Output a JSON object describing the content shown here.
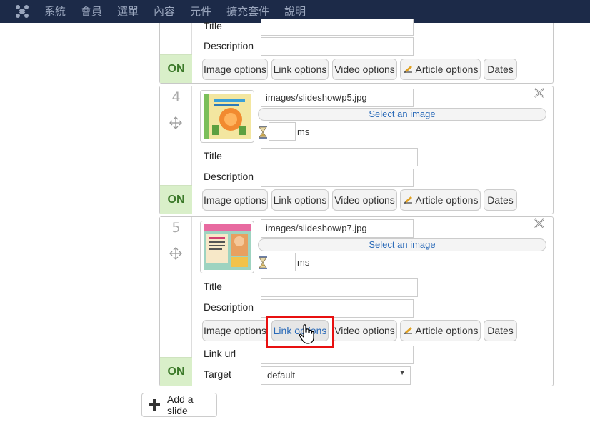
{
  "topbar": {
    "menu": [
      "系統",
      "會員",
      "選單",
      "內容",
      "元件",
      "擴充套件",
      "說明"
    ]
  },
  "colors": {
    "nav_bg": "#1c2a48",
    "on_bg": "#d9efc9",
    "on_text": "#3c7a2a",
    "link_blue": "#2a6ab8",
    "highlight": "#e81010"
  },
  "labels": {
    "title": "Title",
    "description": "Description",
    "on": "ON",
    "select_image": "Select an image",
    "ms": "ms",
    "link_url": "Link url",
    "target": "Target",
    "add_slide": "Add a slide"
  },
  "tabs": {
    "image_options": "Image options",
    "link_options": "Link options",
    "video_options": "Video options",
    "article_options": "Article options",
    "dates": "Dates"
  },
  "slides": [
    {
      "number": "4",
      "path": "images/slideshow/p5.jpg",
      "thumb_icon": "slide-thumbnail-p5"
    },
    {
      "number": "5",
      "path": "images/slideshow/p7.jpg",
      "thumb_icon": "slide-thumbnail-p7"
    }
  ],
  "target_select": {
    "value": "default"
  },
  "icons": [
    "joomla-logo-icon",
    "move-icon",
    "close-icon",
    "hourglass-icon",
    "pencil-icon",
    "plus-icon",
    "hand-cursor-icon"
  ]
}
